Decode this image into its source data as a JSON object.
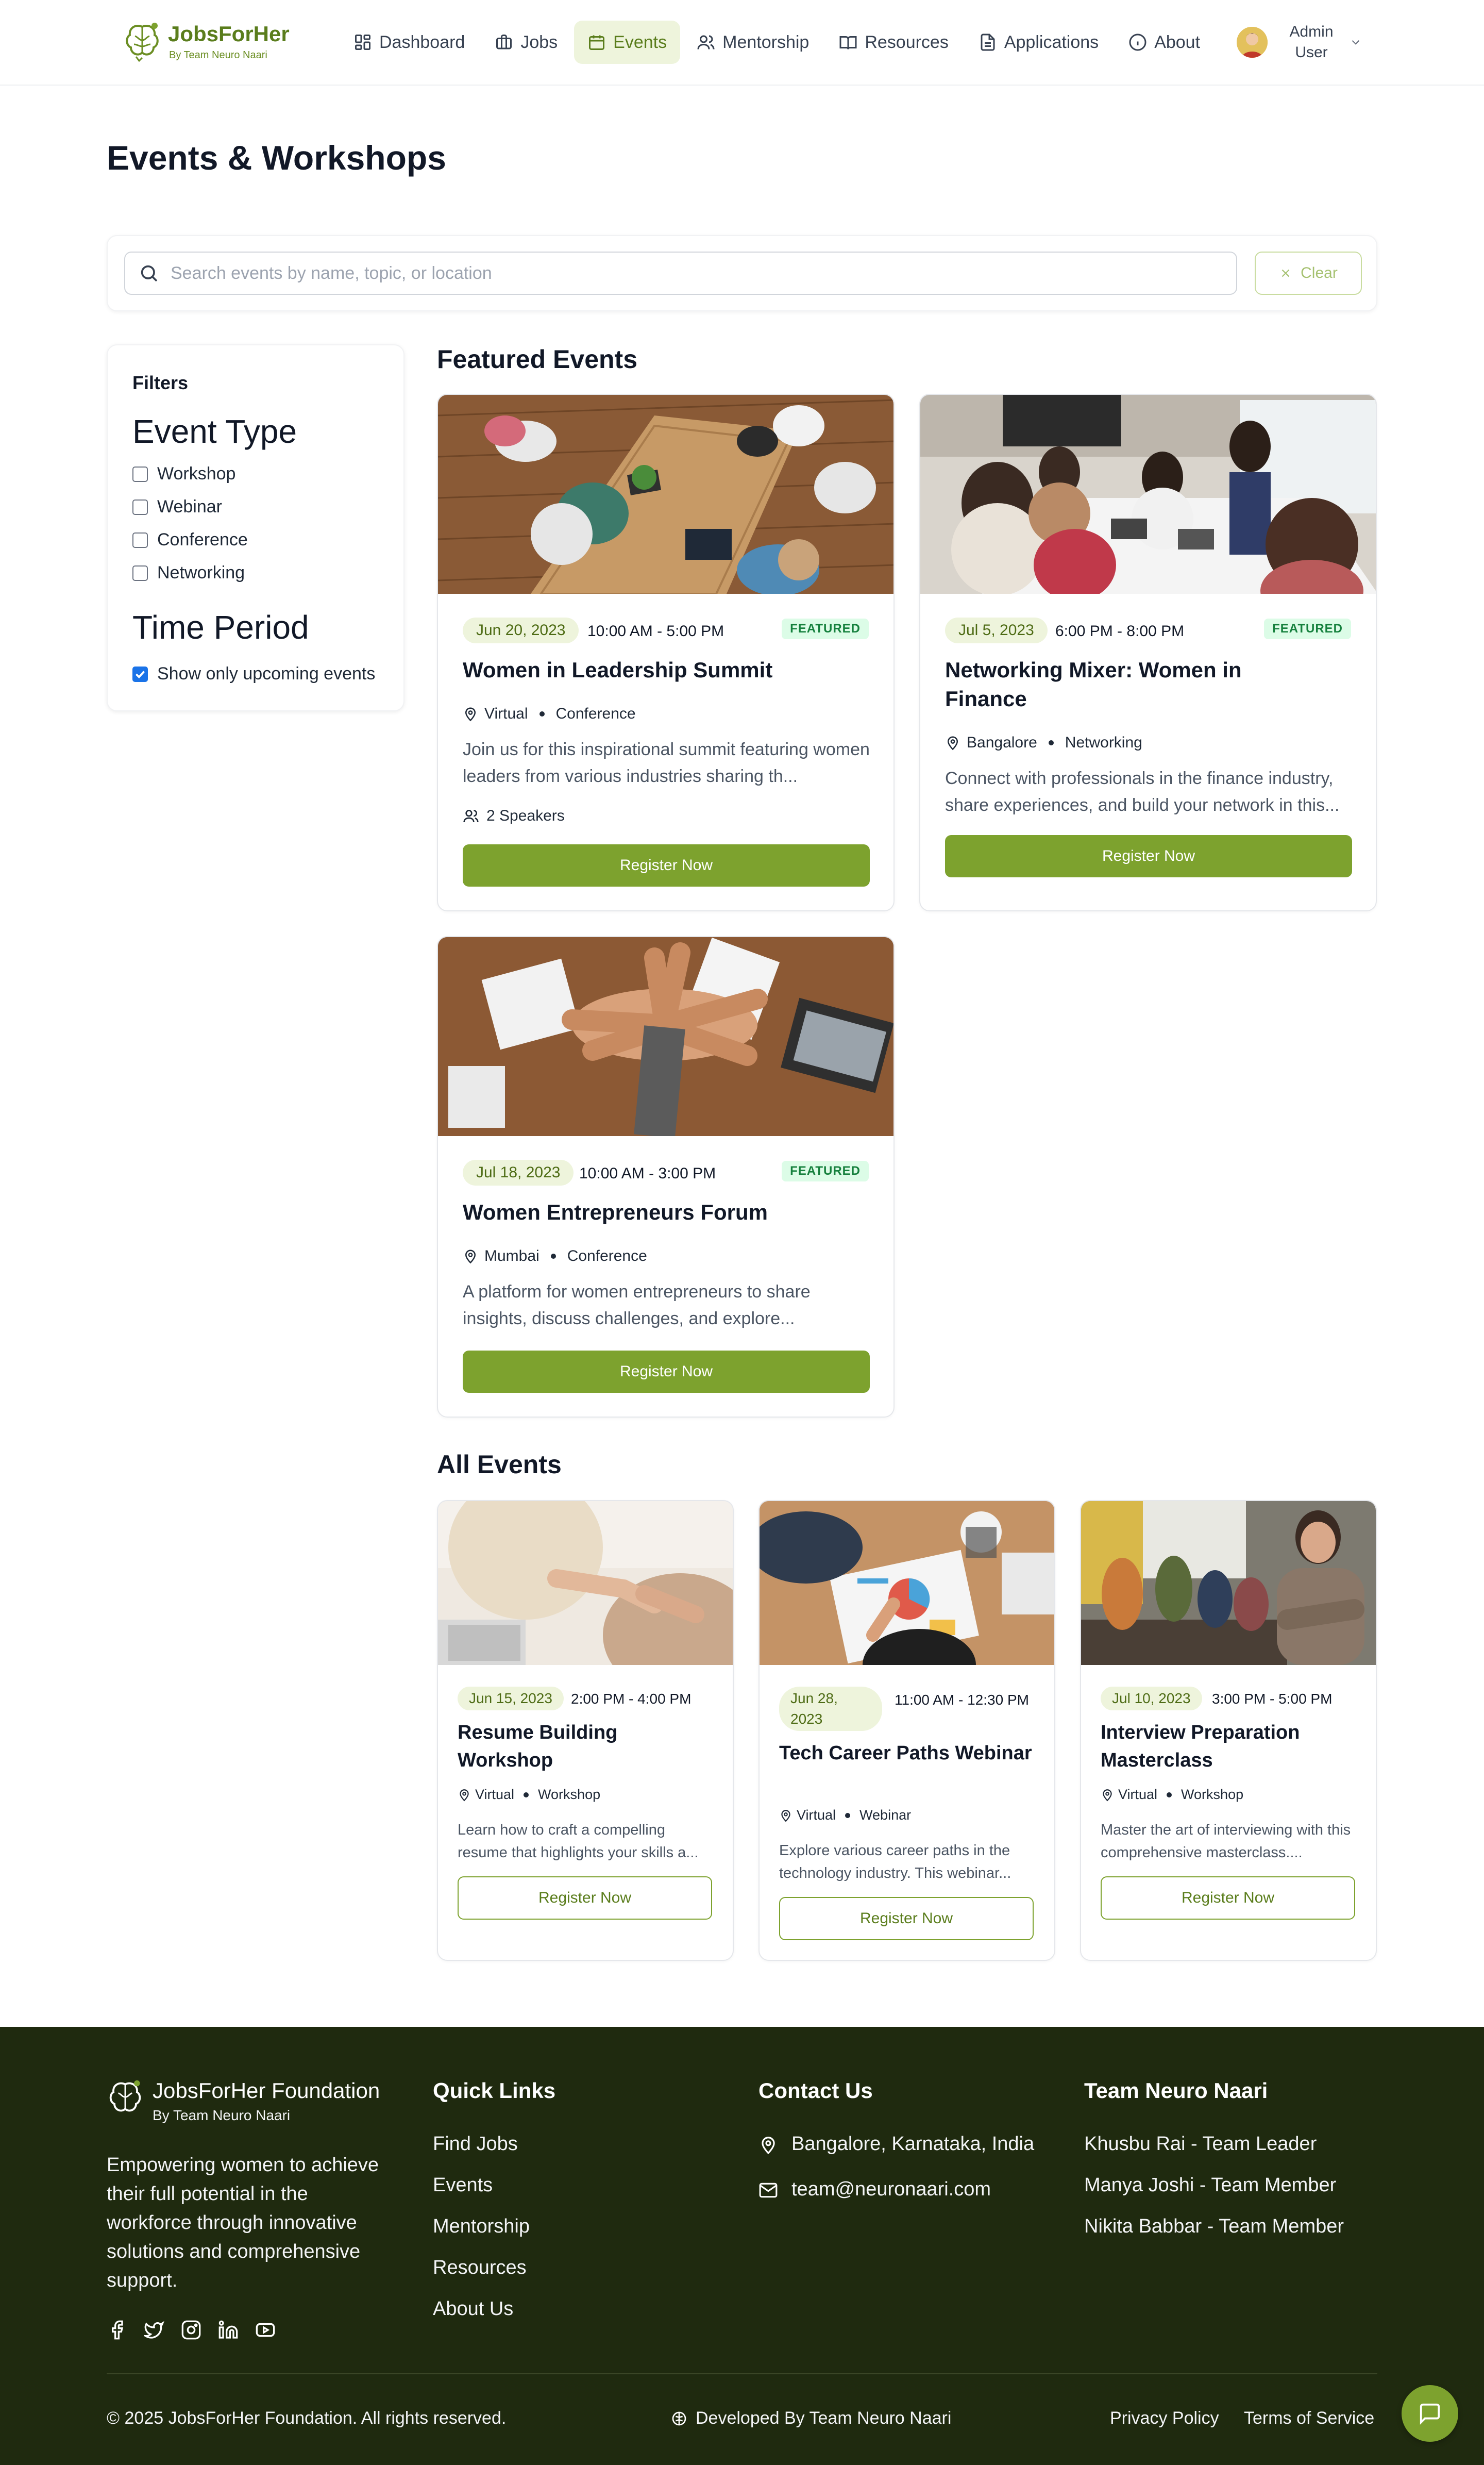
{
  "brand": {
    "name": "JobsForHer",
    "tagline": "By Team Neuro Naari"
  },
  "nav": {
    "items": [
      {
        "label": "Dashboard",
        "icon": "dashboard-icon"
      },
      {
        "label": "Jobs",
        "icon": "briefcase-icon"
      },
      {
        "label": "Events",
        "icon": "calendar-icon",
        "active": true
      },
      {
        "label": "Mentorship",
        "icon": "users-icon"
      },
      {
        "label": "Resources",
        "icon": "book-icon"
      },
      {
        "label": "Applications",
        "icon": "file-icon"
      },
      {
        "label": "About",
        "icon": "info-icon"
      }
    ]
  },
  "user": {
    "name_line1": "Admin",
    "name_line2": "User"
  },
  "page": {
    "title": "Events & Workshops"
  },
  "search": {
    "placeholder": "Search events by name, topic, or location",
    "clear_label": "Clear"
  },
  "filters": {
    "heading": "Filters",
    "event_type_heading": "Event Type",
    "event_types": [
      {
        "label": "Workshop",
        "checked": false
      },
      {
        "label": "Webinar",
        "checked": false
      },
      {
        "label": "Conference",
        "checked": false
      },
      {
        "label": "Networking",
        "checked": false
      }
    ],
    "time_period_heading": "Time Period",
    "upcoming_label": "Show only upcoming events",
    "upcoming_checked": true
  },
  "featured": {
    "heading": "Featured Events",
    "badge": "FEATURED",
    "events": [
      {
        "date": "Jun 20, 2023",
        "time": "10:00 AM - 5:00 PM",
        "title": "Women in Leadership Summit",
        "location": "Virtual",
        "type": "Conference",
        "description": "Join us for this inspirational summit featuring women leaders from various industries sharing th...",
        "speakers": "2 Speakers",
        "button": "Register Now"
      },
      {
        "date": "Jul 5, 2023",
        "time": "6:00 PM - 8:00 PM",
        "title": "Networking Mixer: Women in Finance",
        "location": "Bangalore",
        "type": "Networking",
        "description": "Connect with professionals in the finance industry, share experiences, and build your network in this...",
        "button": "Register Now"
      },
      {
        "date": "Jul 18, 2023",
        "time": "10:00 AM - 3:00 PM",
        "title": "Women Entrepreneurs Forum",
        "location": "Mumbai",
        "type": "Conference",
        "description": "A platform for women entrepreneurs to share insights, discuss challenges, and explore...",
        "button": "Register Now"
      }
    ]
  },
  "all": {
    "heading": "All Events",
    "events": [
      {
        "date": "Jun 15, 2023",
        "time": "2:00 PM - 4:00 PM",
        "title": "Resume Building Workshop",
        "location": "Virtual",
        "type": "Workshop",
        "description": "Learn how to craft a compelling resume that highlights your skills a...",
        "button": "Register Now"
      },
      {
        "date": "Jun 28, 2023",
        "time": "11:00 AM - 12:30 PM",
        "title": "Tech Career Paths Webinar",
        "location": "Virtual",
        "type": "Webinar",
        "description": "Explore various career paths in the technology industry. This webinar...",
        "button": "Register Now"
      },
      {
        "date": "Jul 10, 2023",
        "time": "3:00 PM - 5:00 PM",
        "title": "Interview Preparation Masterclass",
        "location": "Virtual",
        "type": "Workshop",
        "description": "Master the art of interviewing with this comprehensive masterclass....",
        "button": "Register Now"
      }
    ]
  },
  "footer": {
    "org": "JobsForHer Foundation",
    "org_sub": "By Team Neuro Naari",
    "tagline": "Empowering women to achieve their full potential in the workforce through innovative solutions and comprehensive support.",
    "social": [
      "facebook-icon",
      "twitter-icon",
      "instagram-icon",
      "linkedin-icon",
      "youtube-icon"
    ],
    "quick_links_title": "Quick Links",
    "quick_links": [
      "Find Jobs",
      "Events",
      "Mentorship",
      "Resources",
      "About Us"
    ],
    "contact_title": "Contact Us",
    "address": "Bangalore, Karnataka, India",
    "email": "team@neuronaari.com",
    "team_title": "Team Neuro Naari",
    "team": [
      "Khusbu Rai - Team Leader",
      "Manya Joshi - Team Member",
      "Nikita Babbar - Team Member"
    ],
    "copyright": "© 2025 JobsForHer Foundation. All rights reserved.",
    "developed": "Developed By Team Neuro Naari",
    "privacy": "Privacy Policy",
    "terms": "Terms of Service"
  },
  "colors": {
    "accent": "#7da22e",
    "brand_text": "#5a7d1c",
    "footer_bg": "#1f2a0f",
    "pill_bg": "#eef4dc",
    "featured_badge_bg": "#dcfce7"
  }
}
